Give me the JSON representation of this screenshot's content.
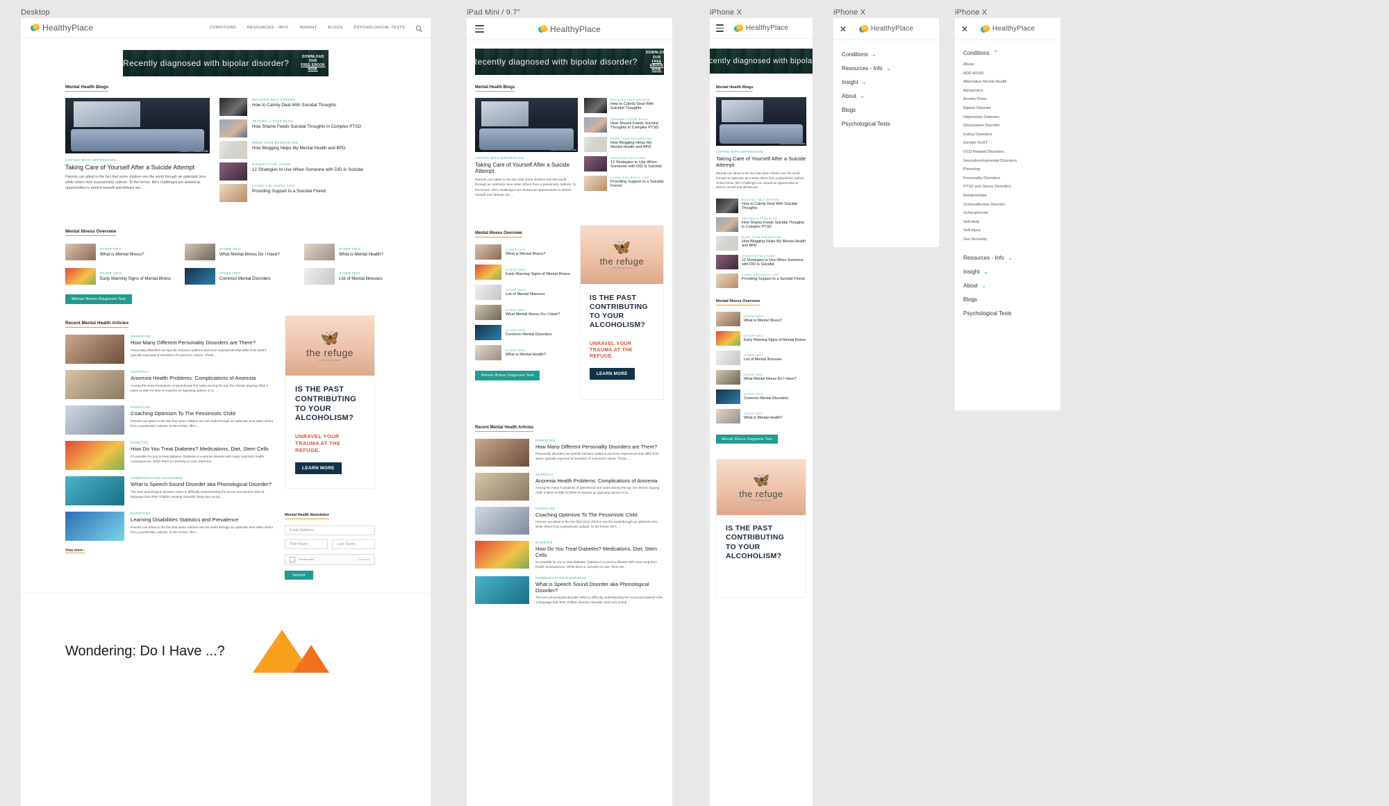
{
  "devices": [
    {
      "label": "Desktop"
    },
    {
      "label": "iPad Mini / 9.7\""
    },
    {
      "label": "iPhone X"
    },
    {
      "label": "iPhone X"
    },
    {
      "label": "iPhone X"
    }
  ],
  "brand": {
    "name": "HealthyPlace",
    "logo_icon": "healthyplace-logo-icon",
    "accent_teal": "#2aa9a0",
    "accent_orange": "#f2921d",
    "button_teal": "#1f9c8f"
  },
  "topnav": {
    "items": [
      "CONDITIONS",
      "RESOURCES - INFO",
      "INSIGHT",
      "BLOGS",
      "PSYCHOLOGICAL TESTS"
    ],
    "search_icon": "search-icon",
    "menu_icon": "hamburger-menu-icon",
    "close_icon": "close-icon"
  },
  "banner": {
    "headline": "Recently diagnosed with bipolar disorder?",
    "cta_line1": "DOWNLOAD OUR",
    "cta_line2": "FREE EBOOK NOW."
  },
  "sections": {
    "blogs_heading": "Mental Health Blogs",
    "overview_heading": "Mental Illness Overview",
    "recent_heading": "Recent Mental Health Articles",
    "newsletter_heading": "Mental Health Newsletter",
    "view_more": "View more ›"
  },
  "featured": {
    "kicker": "COPING WITH DEPRESSION",
    "title": "Taking Care of Yourself After a Suicide Attempt",
    "excerpt": "Parents can attest to the fact that some children see the world through an optimistic lens while others from a pessimistic outlook. To the former, life's challenges are viewed as opportunities to stretch oneself and defeats are ...",
    "watermark": "HEALTHYPLACE.COM",
    "image": "woman-at-window-bedroom-photo"
  },
  "blog_list": [
    {
      "kicker": "BUILDING SELF ESTEEM",
      "title": "How to Calmly Deal With Suicidal Thoughts",
      "image": "man-head-in-hands-photo"
    },
    {
      "kicker": "TRAUMA! A PTSD BLOG",
      "title": "How Shame Feeds Suicidal Thoughts in Complex PTSD",
      "image": "woman-distressed-photo"
    },
    {
      "kicker": "MORE THAN BORDERLINE",
      "title": "How Blogging Helps My Mental Health and BPD",
      "image": "desk-workspace-photo"
    },
    {
      "kicker": "DISSOCIATIVE LIVING",
      "title": "12 Strategies to Use When Someone with DID Is Suicidal",
      "image": "person-in-bed-photo"
    },
    {
      "kicker": "LIVING A BLISSFUL LIFE",
      "title": "Providing Support to a Suicidal Friend",
      "image": "woman-with-mug-photo"
    }
  ],
  "overview_items": [
    {
      "kicker": "OTHER INFO",
      "title": "What is Mental Illness?",
      "image": "woman-portrait-photo"
    },
    {
      "kicker": "OTHER INFO",
      "title": "What Mental Illness Do I Have?",
      "image": "man-dark-photo"
    },
    {
      "kicker": "OTHER INFO",
      "title": "What is Mental Health?",
      "image": "smiling-woman-photo"
    },
    {
      "kicker": "OTHER INFO",
      "title": "Early Warning Signs of Mental Illness",
      "image": "pills-photo"
    },
    {
      "kicker": "OTHER INFO",
      "title": "Common Mental Disorders",
      "image": "blue-abstract-photo"
    },
    {
      "kicker": "OTHER INFO",
      "title": "List of Mental Illnesses",
      "image": "documents-photo"
    }
  ],
  "overview_items_tablet": [
    {
      "kicker": "OTHER INFO",
      "title": "What is Mental Illness?",
      "image": "woman-portrait-photo"
    },
    {
      "kicker": "OTHER INFO",
      "title": "Early Warning Signs of Mental Illness",
      "image": "pills-photo"
    },
    {
      "kicker": "OTHER INFO",
      "title": "List of Mental Illnesses",
      "image": "documents-photo"
    },
    {
      "kicker": "OTHER INFO",
      "title": "What Mental Illness Do I Have?",
      "image": "man-dark-photo"
    },
    {
      "kicker": "OTHER INFO",
      "title": "Common Mental Disorders",
      "image": "blue-abstract-photo"
    },
    {
      "kicker": "OTHER INFO",
      "title": "What is Mental Health?",
      "image": "smiling-woman-photo"
    }
  ],
  "diagnosis_button": "Mental Illness Diagnosis Test",
  "articles": [
    {
      "kicker": "PARENTING",
      "title": "How Many Different Personality Disorders are There?",
      "excerpt": "Personality disorders are specific behavior patterns and inner experiences that differ from what's typically expected of members of a person's culture. These ...",
      "image": "family-tablet-photo"
    },
    {
      "kicker": "ANOREXIA",
      "title": "Anorexia Health Problems: Complications of Anorexia",
      "excerpt": "Among the many frustrations of parenthood one ranks among the top: the chronic arguing child. It takes so little for them to express an opposing opinion or to ...",
      "image": "mother-child-photo"
    },
    {
      "kicker": "PARENTING",
      "title": "Coaching Optimism To The Pessimistic Child",
      "excerpt": "Parents can attest to the fact that some children see the world through an optimistic lens while others from a pessimistic outlook. To the former, life's ...",
      "image": "children-studying-photo"
    },
    {
      "kicker": "DIABETES",
      "title": "How Do You Treat Diabetes? Medications, Diet, Stem Cells",
      "excerpt": "It's possible for you to treat diabetes. Diabetes is a serious disease with many long-term health consequences. While there is currently no cure, there are ...",
      "image": "healthy-food-photo"
    },
    {
      "kicker": "COMMUNICATION DISORDERS",
      "title": "What is Speech Sound Disorder aka Phonological Disorder?",
      "excerpt": "The term phonological disorder refers to difficulty understanding the sound and speech rules of language that other children develop naturally. Most very young ...",
      "image": "teacher-child-photo"
    },
    {
      "kicker": "PARENTING",
      "title": "Learning Disabilities Statistics and Prevalence",
      "excerpt": "Parents can attest to the fact that some children see the world through an optimistic lens while others from a pessimistic outlook. To the former, life's ...",
      "image": "brain-scan-photo"
    }
  ],
  "refuge_ad": {
    "bird_icon": "bird-logo-icon",
    "name": "the refuge",
    "subtitle": "a healing place",
    "headline": "IS THE PAST CONTRIBUTING TO YOUR ALCOHOLISM?",
    "middle": "UNRAVEL YOUR TRAUMA AT THE REFUGE.",
    "button": "LEARN MORE"
  },
  "newsletter": {
    "email_placeholder": "Email Address",
    "first_placeholder": "First Name",
    "last_placeholder": "Last Name",
    "recaptcha_label": "I'm not a robot",
    "recaptcha_brand": "reCAPTCHA",
    "submit": "Submit"
  },
  "bottom_hero": {
    "title": "Wondering: Do I Have ...?"
  },
  "mobile_menu_collapsed": {
    "items": [
      {
        "label": "Conditions",
        "expandable": true
      },
      {
        "label": "Resources - Info",
        "expandable": true
      },
      {
        "label": "Insight",
        "expandable": true
      },
      {
        "label": "About",
        "expandable": true
      },
      {
        "label": "Blogs",
        "expandable": false
      },
      {
        "label": "Psychological Tests",
        "expandable": false
      }
    ]
  },
  "mobile_menu_expanded": {
    "expanded_label": "Conditions",
    "conditions": [
      "Abuse",
      "ADD-ADHD",
      "Alternative Mental Health",
      "Alzheimer's",
      "Anxiety-Panic",
      "Bipolar Disorder",
      "Depression Diabetes",
      "Dissociative Disorder",
      "Eating Disorders",
      "Gender-GLBT",
      "OCD Related Disorders",
      "Neurodevelopmental Disorders",
      "Parenting",
      "Personality Disorders",
      "PTSD and Stress Disorders",
      "Relationships",
      "Schizoaffective Disorder",
      "Schizophrenia",
      "Self-Help",
      "Self-Injury",
      "Sex-Sexuality"
    ],
    "after_items": [
      {
        "label": "Resources - Info",
        "expandable": true
      },
      {
        "label": "Insight",
        "expandable": true
      },
      {
        "label": "About",
        "expandable": true
      },
      {
        "label": "Blogs",
        "expandable": false
      },
      {
        "label": "Psychological Tests",
        "expandable": false
      }
    ]
  }
}
